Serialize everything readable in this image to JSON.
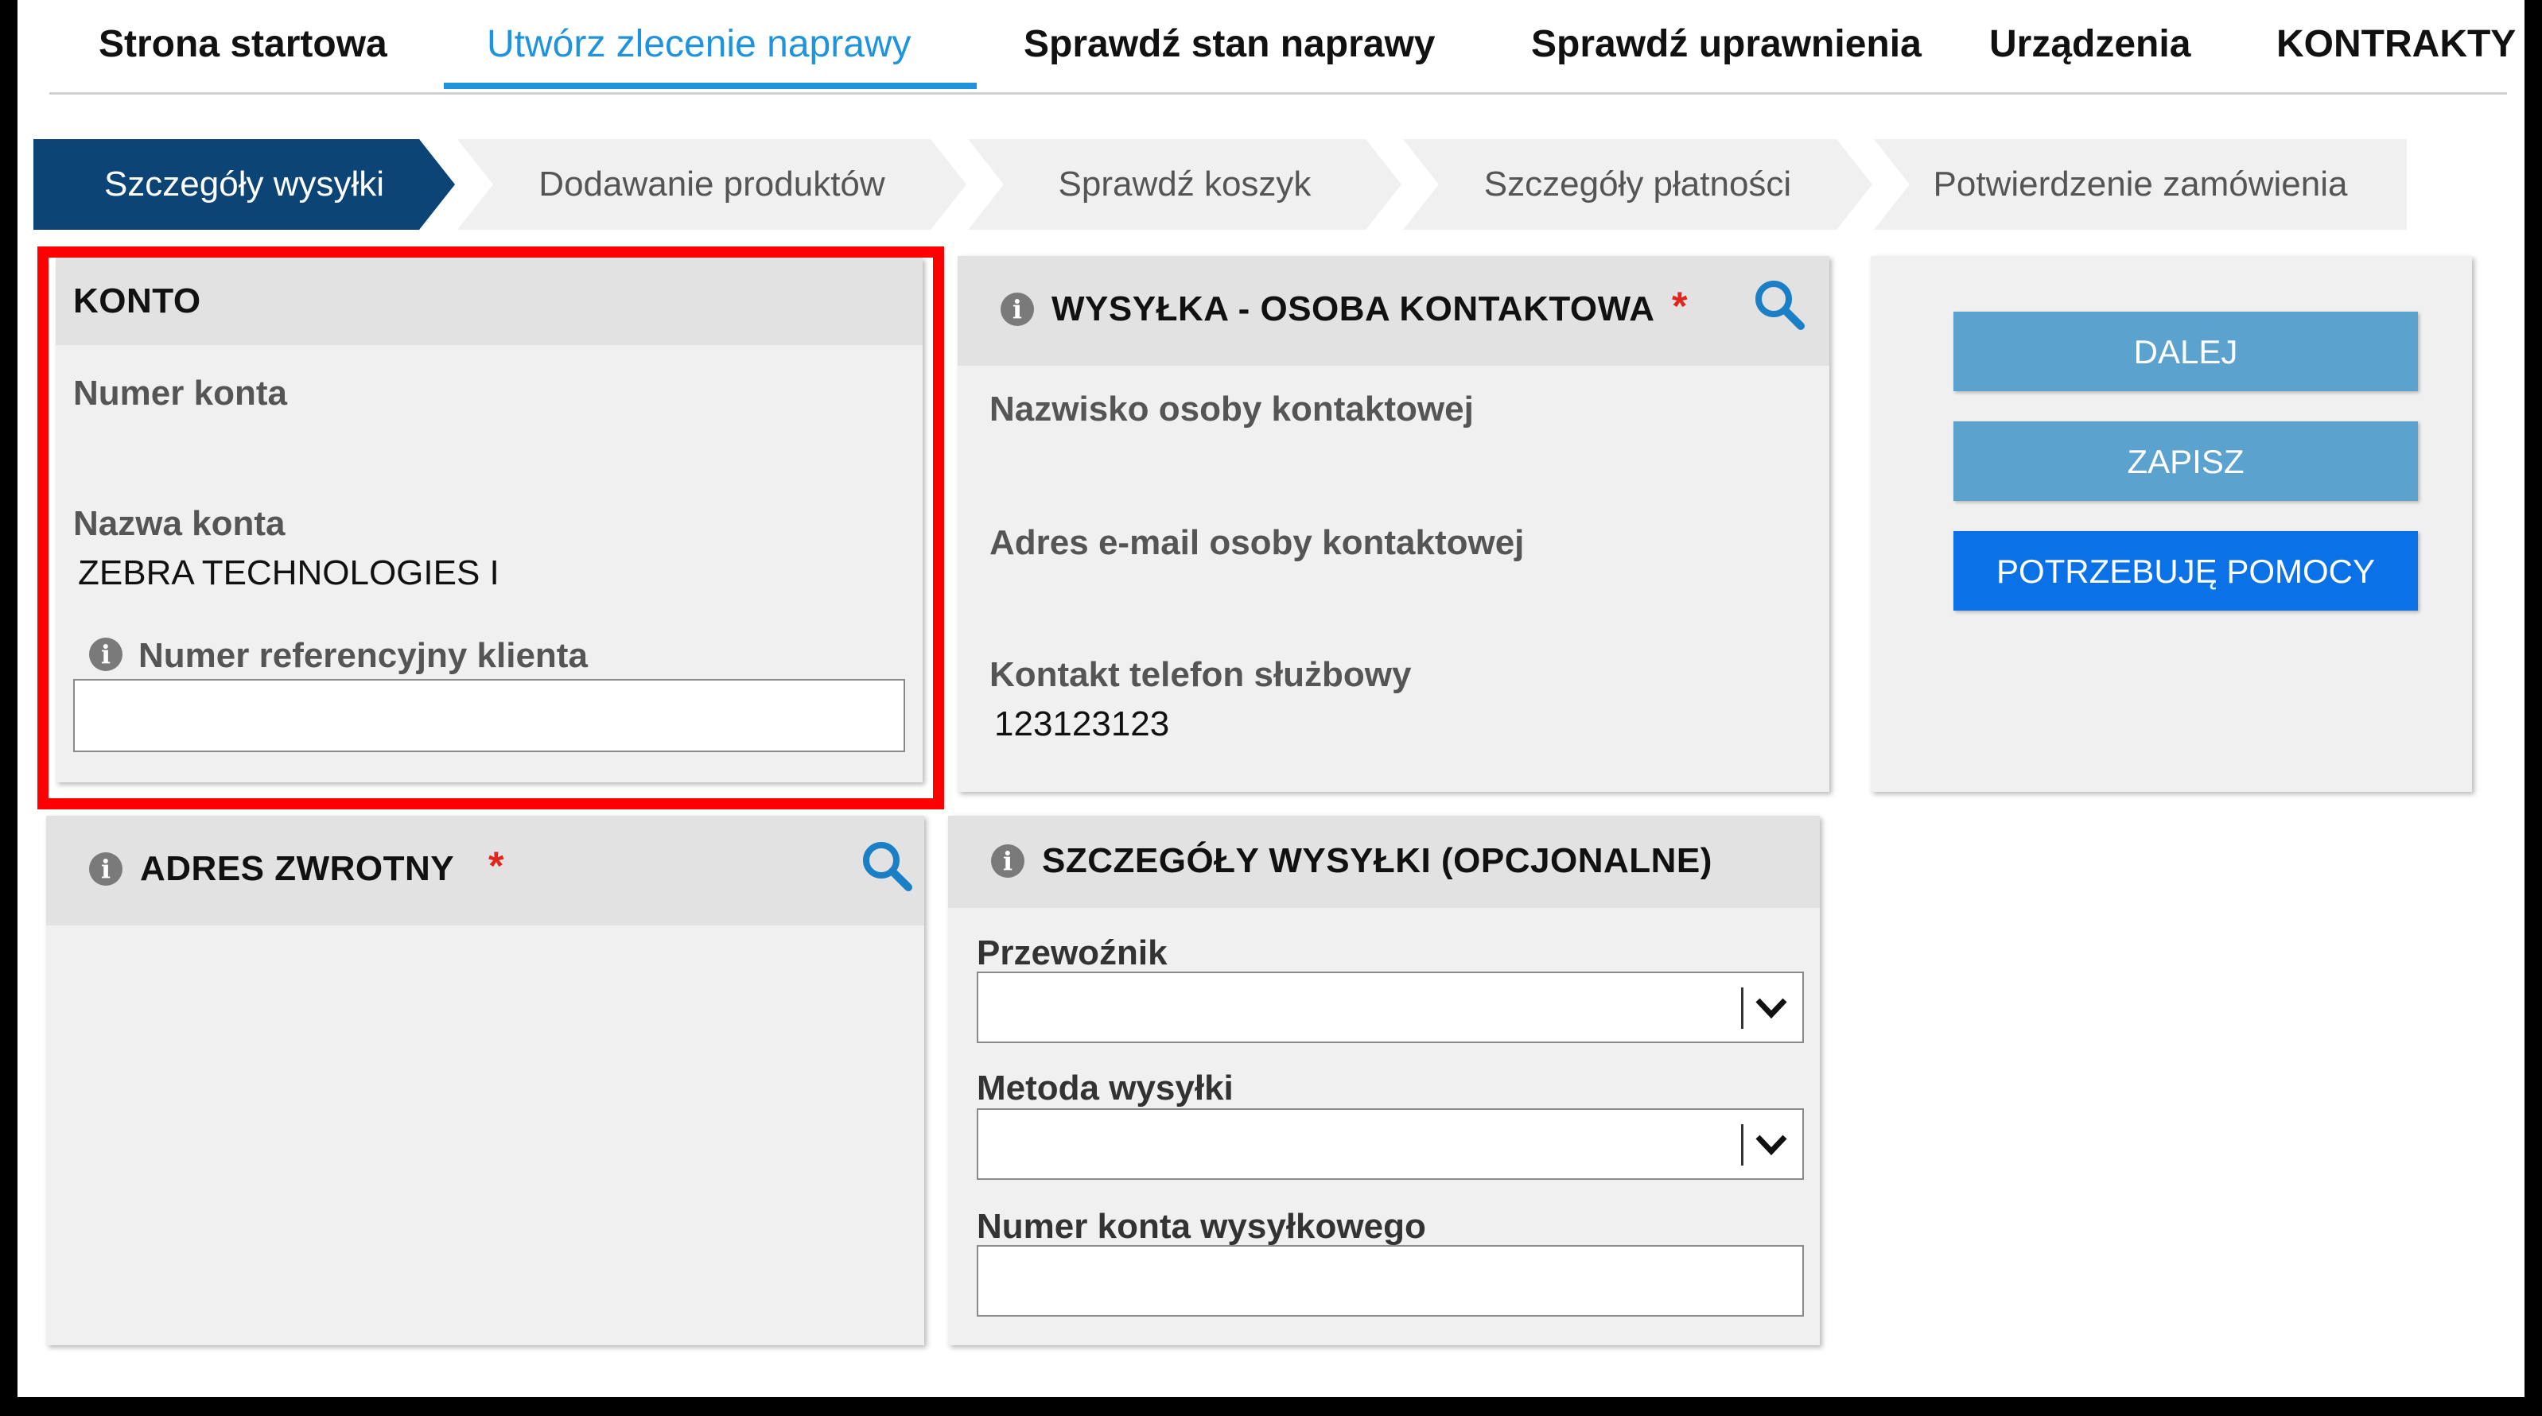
{
  "nav": {
    "items": [
      {
        "label": "Strona startowa"
      },
      {
        "label": "Utwórz zlecenie naprawy",
        "active": true
      },
      {
        "label": "Sprawdź stan naprawy"
      },
      {
        "label": "Sprawdź uprawnienia"
      },
      {
        "label": "Urządzenia"
      },
      {
        "label": "KONTRAKTY"
      }
    ]
  },
  "steps": [
    {
      "label": "Szczegóły wysyłki",
      "active": true
    },
    {
      "label": "Dodawanie produktów"
    },
    {
      "label": "Sprawdź koszyk"
    },
    {
      "label": "Szczegóły płatności"
    },
    {
      "label": "Potwierdzenie zamówienia"
    }
  ],
  "account": {
    "title": "KONTO",
    "number_label": "Numer konta",
    "number_value": "",
    "name_label": "Nazwa konta",
    "name_value": "ZEBRA TECHNOLOGIES I",
    "ref_label": "Numer referencyjny klienta",
    "ref_value": "",
    "ref_placeholder": ""
  },
  "contact": {
    "title": "WYSYŁKA - OSOBA KONTAKTOWA",
    "required_mark": "*",
    "name_label": "Nazwisko osoby kontaktowej",
    "name_value": "",
    "email_label": "Adres e-mail osoby kontaktowej",
    "email_value": "",
    "phone_label": "Kontakt telefon służbowy",
    "phone_value": "123123123"
  },
  "return_address": {
    "title": "ADRES ZWROTNY",
    "required_mark": "*"
  },
  "shipping": {
    "title": "SZCZEGÓŁY WYSYŁKI (OPCJONALNE)",
    "carrier_label": "Przewoźnik",
    "carrier_value": "",
    "method_label": "Metoda wysyłki",
    "method_value": "",
    "account_label": "Numer konta wysyłkowego",
    "account_value": ""
  },
  "actions": {
    "next": "DALEJ",
    "save": "ZAPISZ",
    "help": "POTRZEBUJĘ POMOCY"
  },
  "colors": {
    "accent": "#1f94dd",
    "step_active": "#0b4475",
    "button_light": "#5ba2cf",
    "button_primary": "#0a72e6",
    "required": "#e0261c",
    "highlight_border": "#ff0000"
  },
  "icons": {
    "info": "info-icon",
    "search": "search-icon",
    "dropdown": "chevron-down-icon"
  }
}
